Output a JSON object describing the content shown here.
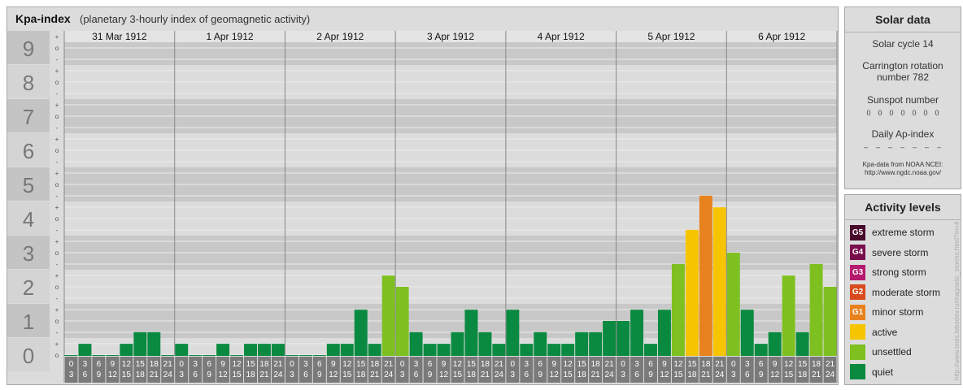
{
  "header": {
    "title": "Kpa-index",
    "subtitle": "(planetary 3-hourly index of geomagnetic activity)"
  },
  "chart_data": {
    "type": "bar",
    "title": "Kpa-index",
    "subtitle": "(planetary 3-hourly index of geomagnetic activity)",
    "ylim": [
      0,
      9
    ],
    "y_ticks": [
      "0",
      "1",
      "2",
      "3",
      "4",
      "5",
      "6",
      "7",
      "8",
      "9"
    ],
    "sub_ticks": [
      "o",
      "+",
      "-"
    ],
    "days": [
      "31 Mar 1912",
      "1 Apr 1912",
      "2 Apr 1912",
      "3 Apr 1912",
      "4 Apr 1912",
      "5 Apr 1912",
      "6 Apr 1912"
    ],
    "interval_start_labels": [
      "0",
      "3",
      "6",
      "9",
      "12",
      "15",
      "18",
      "21"
    ],
    "interval_end_labels": [
      "3",
      "6",
      "9",
      "12",
      "15",
      "18",
      "21",
      "24"
    ],
    "values": [
      [
        0.0,
        0.33,
        0.0,
        0.0,
        0.33,
        0.67,
        0.67,
        0.0
      ],
      [
        0.33,
        0.0,
        0.0,
        0.33,
        0.0,
        0.33,
        0.33,
        0.33
      ],
      [
        0.0,
        0.0,
        0.0,
        0.33,
        0.33,
        1.33,
        0.33,
        2.33
      ],
      [
        2.0,
        0.67,
        0.33,
        0.33,
        0.67,
        1.33,
        0.67,
        0.33
      ],
      [
        1.33,
        0.33,
        0.67,
        0.33,
        0.33,
        0.67,
        0.67,
        1.0
      ],
      [
        1.0,
        1.33,
        0.33,
        1.33,
        2.67,
        3.67,
        4.67,
        4.33
      ],
      [
        3.0,
        1.33,
        0.33,
        0.67,
        2.33,
        0.67,
        2.67,
        2.0
      ]
    ],
    "grid": true,
    "legend": "right"
  },
  "solar": {
    "heading": "Solar data",
    "cycle": "Solar cycle 14",
    "carrington_1": "Carrington rotation",
    "carrington_2": "number 782",
    "sunspot_label": "Sunspot number",
    "sunspot_values": [
      "0",
      "0",
      "0",
      "0",
      "0",
      "0",
      "0"
    ],
    "ap_label": "Daily Ap-index",
    "ap_values": [
      "–",
      "–",
      "–",
      "–",
      "–",
      "–",
      "–"
    ],
    "source_1": "Kpa-data from NOAA NCEI:",
    "source_2": "http://www.ngdc.noaa.gov/"
  },
  "activity": {
    "heading": "Activity levels",
    "levels": [
      {
        "code": "G5",
        "label": "extreme storm",
        "color": "#4a0a2c"
      },
      {
        "code": "G4",
        "label": "severe storm",
        "color": "#7a0e4c"
      },
      {
        "code": "G3",
        "label": "strong storm",
        "color": "#b51a6e"
      },
      {
        "code": "G2",
        "label": "moderate storm",
        "color": "#d94a1e"
      },
      {
        "code": "G1",
        "label": "minor storm",
        "color": "#e8821e"
      },
      {
        "code": "",
        "label": "active",
        "color": "#f6c400"
      },
      {
        "code": "",
        "label": "unsettled",
        "color": "#7ec020"
      },
      {
        "code": "",
        "label": "quiet",
        "color": "#0a8a40"
      }
    ]
  },
  "watermark": "http://www.tesis.lebedev.ru/magnetic_storms.html?m=4"
}
